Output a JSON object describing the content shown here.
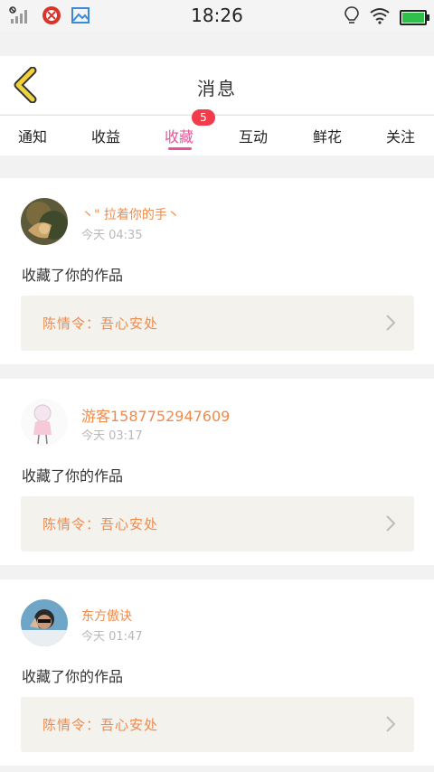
{
  "status_bar": {
    "time": "18:26",
    "left_icons": [
      "no-signal-icon",
      "app-notification-icon",
      "image-icon"
    ],
    "right_icons": [
      "bulb-icon",
      "wifi-icon",
      "battery-icon"
    ]
  },
  "header": {
    "title": "消息",
    "back_icon": "chevron-left-icon",
    "accent_color": "#f1d23a"
  },
  "tabs": {
    "items": [
      {
        "label": "通知"
      },
      {
        "label": "收益"
      },
      {
        "label": "收藏"
      },
      {
        "label": "互动"
      },
      {
        "label": "鲜花"
      },
      {
        "label": "关注"
      }
    ],
    "active_index": 2,
    "badge": "5",
    "active_color": "#e5529a",
    "badge_color": "#f23b4b"
  },
  "messages": [
    {
      "name": "丶\" 拉着你的手丶",
      "time": "今天 04:35",
      "action": "收藏了你的作品",
      "work": "陈情令：吾心安处"
    },
    {
      "name": "游客1587752947609",
      "time": "今天 03:17",
      "action": "收藏了你的作品",
      "work": "陈情令：吾心安处"
    },
    {
      "name": "东方傲诀",
      "time": "今天 01:47",
      "action": "收藏了你的作品",
      "work": "陈情令：吾心安处"
    }
  ],
  "colors": {
    "name_color": "#f08a4b",
    "time_color": "#b8b8b8",
    "work_box_bg": "#f4f2ec"
  }
}
